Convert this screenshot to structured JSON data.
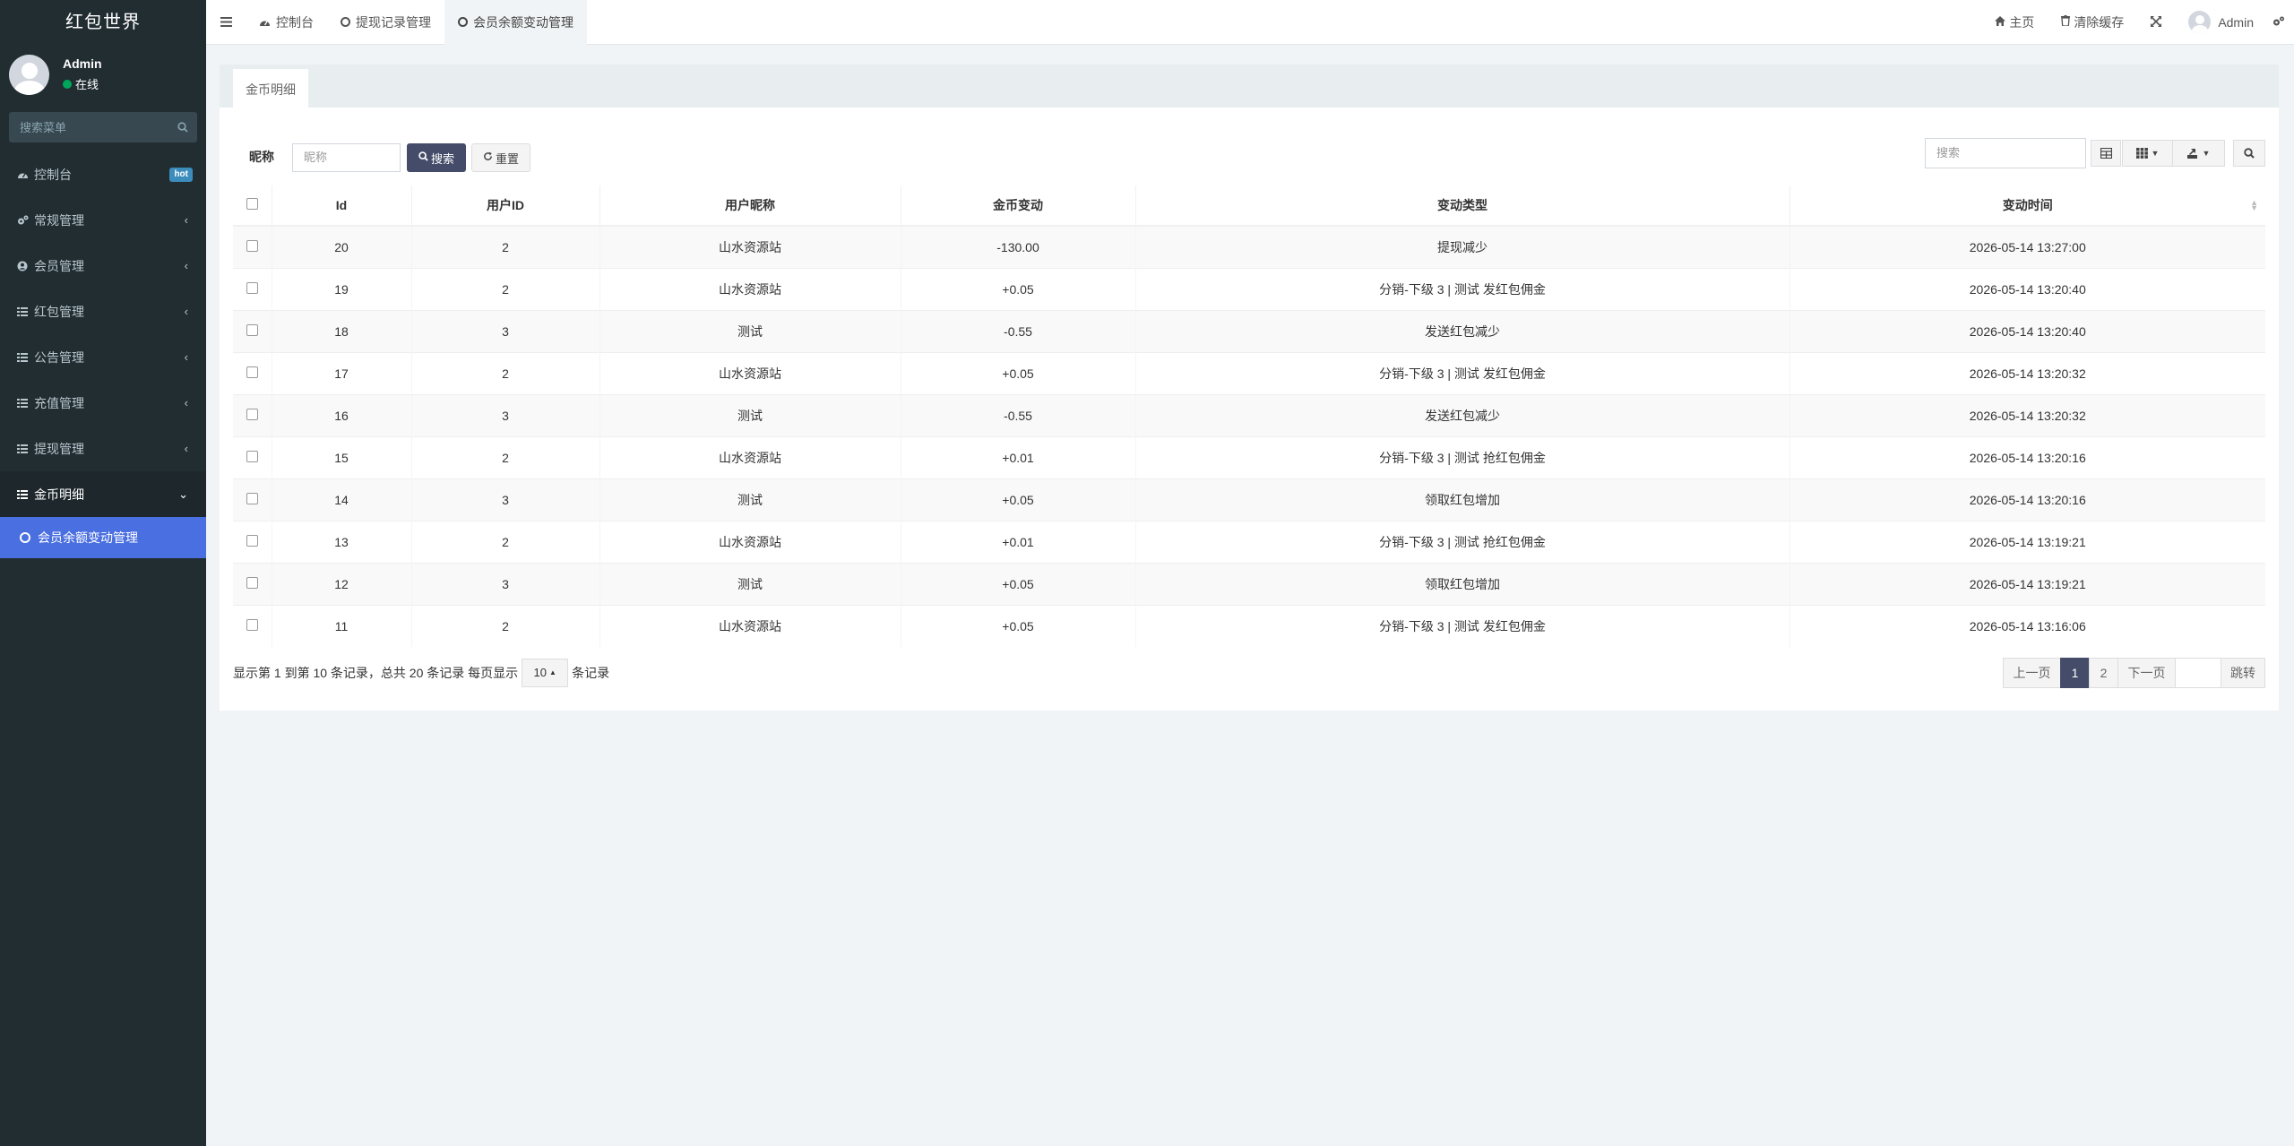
{
  "app": {
    "title": "红包世界"
  },
  "user": {
    "name": "Admin",
    "status": "在线"
  },
  "sidebar": {
    "search_placeholder": "搜索菜单",
    "items": [
      {
        "label": "控制台",
        "icon": "dashboard-icon",
        "badge": "hot"
      },
      {
        "label": "常规管理",
        "icon": "cogs-icon"
      },
      {
        "label": "会员管理",
        "icon": "user-circle-icon"
      },
      {
        "label": "红包管理",
        "icon": "list-icon"
      },
      {
        "label": "公告管理",
        "icon": "list-icon"
      },
      {
        "label": "充值管理",
        "icon": "list-icon"
      },
      {
        "label": "提现管理",
        "icon": "list-icon"
      },
      {
        "label": "金币明细",
        "icon": "list-icon"
      }
    ],
    "subitem": {
      "label": "会员余额变动管理"
    }
  },
  "topbar": {
    "tabs": [
      {
        "label": "控制台",
        "icon": "dashboard-icon"
      },
      {
        "label": "提现记录管理",
        "icon": "circle-icon"
      },
      {
        "label": "会员余额变动管理",
        "icon": "circle-icon"
      }
    ],
    "home": "主页",
    "clear_cache": "清除缓存",
    "admin": "Admin"
  },
  "panel": {
    "tab": "金币明细"
  },
  "filter": {
    "label": "昵称",
    "placeholder": "昵称",
    "search_btn": "搜索",
    "reset_btn": "重置",
    "table_search_placeholder": "搜索"
  },
  "table": {
    "headers": [
      "Id",
      "用户ID",
      "用户昵称",
      "金币变动",
      "变动类型",
      "变动时间"
    ],
    "rows": [
      [
        "20",
        "2",
        "山水资源站",
        "-130.00",
        "提现减少",
        "2026-05-14 13:27:00"
      ],
      [
        "19",
        "2",
        "山水资源站",
        "+0.05",
        "分销-下级 3 | 测试 发红包佣金",
        "2026-05-14 13:20:40"
      ],
      [
        "18",
        "3",
        "测试",
        "-0.55",
        "发送红包减少",
        "2026-05-14 13:20:40"
      ],
      [
        "17",
        "2",
        "山水资源站",
        "+0.05",
        "分销-下级 3 | 测试 发红包佣金",
        "2026-05-14 13:20:32"
      ],
      [
        "16",
        "3",
        "测试",
        "-0.55",
        "发送红包减少",
        "2026-05-14 13:20:32"
      ],
      [
        "15",
        "2",
        "山水资源站",
        "+0.01",
        "分销-下级 3 | 测试 抢红包佣金",
        "2026-05-14 13:20:16"
      ],
      [
        "14",
        "3",
        "测试",
        "+0.05",
        "领取红包增加",
        "2026-05-14 13:20:16"
      ],
      [
        "13",
        "2",
        "山水资源站",
        "+0.01",
        "分销-下级 3 | 测试 抢红包佣金",
        "2026-05-14 13:19:21"
      ],
      [
        "12",
        "3",
        "测试",
        "+0.05",
        "领取红包增加",
        "2026-05-14 13:19:21"
      ],
      [
        "11",
        "2",
        "山水资源站",
        "+0.05",
        "分销-下级 3 | 测试 发红包佣金",
        "2026-05-14 13:16:06"
      ]
    ]
  },
  "pagination": {
    "info_prefix": "显示第 1 到第 10 条记录，总共 20 条记录 每页显示",
    "page_size": "10",
    "info_suffix": "条记录",
    "prev": "上一页",
    "pages": [
      "1",
      "2"
    ],
    "next": "下一页",
    "jump": "跳转"
  },
  "colors": {
    "sidebar_bg": "#222d32",
    "active_sub": "#4a6fe0",
    "primary_btn": "#444c69",
    "online": "#00a65a",
    "hot_badge": "#3c8dbc"
  }
}
